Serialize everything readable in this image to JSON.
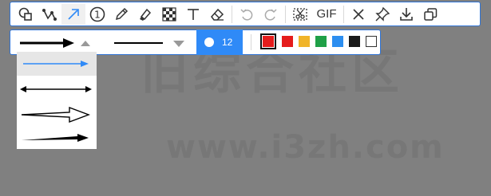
{
  "watermark": {
    "text": "旧综合社区",
    "url": "www.i3zh.com"
  },
  "toolbar": {
    "tools": [
      {
        "name": "shape-icon"
      },
      {
        "name": "polyline-icon"
      },
      {
        "name": "arrow-icon",
        "active": true
      },
      {
        "name": "number-icon",
        "label": "1"
      },
      {
        "name": "pencil-icon"
      },
      {
        "name": "marker-icon"
      },
      {
        "name": "mosaic-icon"
      },
      {
        "name": "text-icon",
        "label": "T"
      },
      {
        "name": "eraser-icon"
      },
      {
        "name": "undo-icon"
      },
      {
        "name": "redo-icon"
      },
      {
        "name": "screenshot-icon"
      },
      {
        "name": "gif-label",
        "label": "GIF"
      },
      {
        "name": "close-icon"
      },
      {
        "name": "pin-icon"
      },
      {
        "name": "download-icon"
      },
      {
        "name": "copy-icon"
      }
    ]
  },
  "options": {
    "size_value": "12",
    "colors": [
      {
        "hex": "#e51c1c",
        "selected": true
      },
      {
        "hex": "#e51c1c",
        "selected": false
      },
      {
        "hex": "#f0b429",
        "selected": false
      },
      {
        "hex": "#1fa047",
        "selected": false
      },
      {
        "hex": "#2c8ef0",
        "selected": false
      },
      {
        "hex": "#1a1a1a",
        "selected": false
      },
      {
        "hex": "#ffffff",
        "selected": false
      }
    ]
  },
  "arrow_styles": [
    "thick-arrow-icon",
    "blue-arrow-icon",
    "double-arrow-icon",
    "hollow-arrow-icon",
    "thin-arrow-icon"
  ]
}
